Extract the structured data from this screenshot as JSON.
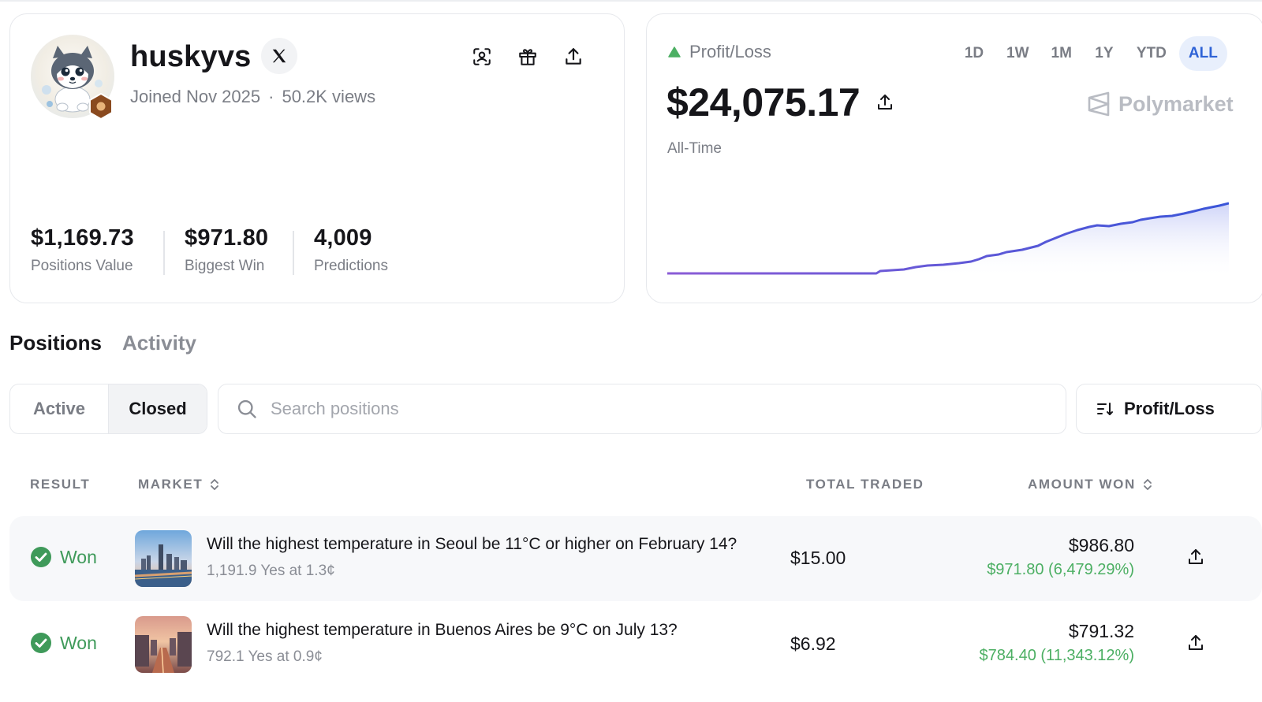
{
  "profile": {
    "username": "huskyvs",
    "joined": "Joined Nov 2025",
    "views": "50.2K views",
    "separator": "·",
    "stats": [
      {
        "value": "$1,169.73",
        "label": "Positions Value"
      },
      {
        "value": "$971.80",
        "label": "Biggest Win"
      },
      {
        "value": "4,009",
        "label": "Predictions"
      }
    ]
  },
  "pnl": {
    "label": "Profit/Loss",
    "ranges": [
      "1D",
      "1W",
      "1M",
      "1Y",
      "YTD",
      "ALL"
    ],
    "active_range": "ALL",
    "amount": "$24,075.17",
    "period": "All-Time",
    "brand": "Polymarket",
    "colors": {
      "line_start": "#8b5cd6",
      "line_end": "#3a55d8",
      "fill": "#dfe3fb"
    }
  },
  "tabs": {
    "positions": "Positions",
    "activity": "Activity"
  },
  "filter": {
    "active": "Active",
    "closed": "Closed",
    "selected": "Closed"
  },
  "search": {
    "placeholder": "Search positions"
  },
  "sort": {
    "label": "Profit/Loss"
  },
  "table": {
    "headers": {
      "result": "RESULT",
      "market": "MARKET",
      "total_traded": "TOTAL TRADED",
      "amount_won": "AMOUNT WON"
    },
    "rows": [
      {
        "result": "Won",
        "title": "Will the highest temperature in Seoul be 11°C or higher on February 14?",
        "subtitle": "1,191.9 Yes at 1.3¢",
        "total_traded": "$15.00",
        "amount_won": "$986.80",
        "gain": "$971.80 (6,479.29%)"
      },
      {
        "result": "Won",
        "title": "Will the highest temperature in Buenos Aires be 9°C on July 13?",
        "subtitle": "792.1 Yes at 0.9¢",
        "total_traded": "$6.92",
        "amount_won": "$791.32",
        "gain": "$784.40 (11,343.12%)"
      }
    ]
  }
}
